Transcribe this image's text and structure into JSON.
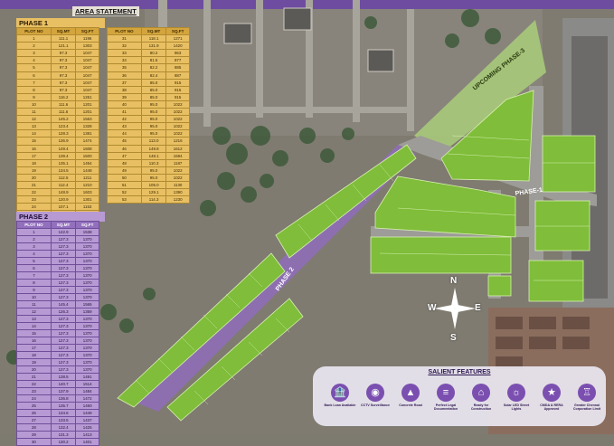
{
  "area_statement": {
    "title": "AREA STATEMENT"
  },
  "phase1_table": {
    "title": "PHASE 1",
    "headers": [
      "PLOT NO",
      "SQ.MT",
      "SQ.FT"
    ],
    "rows_left": [
      [
        "1",
        "111.1",
        "1196"
      ],
      [
        "2",
        "121.1",
        "1303"
      ],
      [
        "3",
        "97.3",
        "1047"
      ],
      [
        "4",
        "97.3",
        "1047"
      ],
      [
        "5",
        "97.3",
        "1047"
      ],
      [
        "6",
        "97.3",
        "1047"
      ],
      [
        "7",
        "97.3",
        "1047"
      ],
      [
        "8",
        "97.3",
        "1047"
      ],
      [
        "9",
        "116.2",
        "1251"
      ],
      [
        "10",
        "111.6",
        "1201"
      ],
      [
        "11",
        "111.6",
        "1201"
      ],
      [
        "12",
        "145.2",
        "1563"
      ],
      [
        "13",
        "123.4",
        "1328"
      ],
      [
        "14",
        "128.3",
        "1381"
      ],
      [
        "15",
        "136.9",
        "1474"
      ],
      [
        "16",
        "149.4",
        "1608"
      ],
      [
        "17",
        "139.4",
        "1500"
      ],
      [
        "18",
        "135.1",
        "1454"
      ],
      [
        "19",
        "134.5",
        "1448"
      ],
      [
        "20",
        "112.5",
        "1211"
      ],
      [
        "21",
        "112.4",
        "1210"
      ],
      [
        "22",
        "148.9",
        "1603"
      ],
      [
        "23",
        "120.9",
        "1301"
      ],
      [
        "24",
        "107.1",
        "1153"
      ],
      [
        "25",
        "102.3",
        "1101"
      ],
      [
        "26",
        "102.3",
        "1101"
      ],
      [
        "27",
        "119.5",
        "1286"
      ],
      [
        "28",
        "134.5",
        "1448"
      ],
      [
        "29",
        "134.5",
        "1448"
      ],
      [
        "30",
        "110.5",
        "1189"
      ]
    ],
    "rows_right": [
      [
        "31",
        "118.1",
        "1271"
      ],
      [
        "32",
        "131.9",
        "1420"
      ],
      [
        "33",
        "80.2",
        "863"
      ],
      [
        "34",
        "81.5",
        "877"
      ],
      [
        "35",
        "82.2",
        "885"
      ],
      [
        "36",
        "82.4",
        "887"
      ],
      [
        "37",
        "85.0",
        "915"
      ],
      [
        "38",
        "85.0",
        "915"
      ],
      [
        "39",
        "85.0",
        "915"
      ],
      [
        "40",
        "95.0",
        "1022"
      ],
      [
        "41",
        "95.0",
        "1022"
      ],
      [
        "42",
        "95.0",
        "1022"
      ],
      [
        "43",
        "95.0",
        "1022"
      ],
      [
        "44",
        "95.0",
        "1022"
      ],
      [
        "45",
        "113.0",
        "1216"
      ],
      [
        "46",
        "149.8",
        "1612"
      ],
      [
        "47",
        "148.1",
        "1594"
      ],
      [
        "48",
        "110.3",
        "1187"
      ],
      [
        "49",
        "95.0",
        "1022"
      ],
      [
        "50",
        "95.0",
        "1022"
      ],
      [
        "51",
        "105.0",
        "1130"
      ],
      [
        "52",
        "129.1",
        "1390"
      ],
      [
        "53",
        "114.3",
        "1230"
      ]
    ]
  },
  "phase2_table": {
    "title": "PHASE 2",
    "headers": [
      "PLOT NO",
      "SQ.MT",
      "SQ.FT"
    ],
    "rows": [
      [
        "1",
        "142.9",
        "1538"
      ],
      [
        "2",
        "127.3",
        "1370"
      ],
      [
        "3",
        "127.3",
        "1370"
      ],
      [
        "4",
        "127.3",
        "1370"
      ],
      [
        "5",
        "127.3",
        "1370"
      ],
      [
        "6",
        "127.3",
        "1370"
      ],
      [
        "7",
        "127.3",
        "1370"
      ],
      [
        "8",
        "127.3",
        "1370"
      ],
      [
        "9",
        "127.3",
        "1370"
      ],
      [
        "10",
        "127.3",
        "1370"
      ],
      [
        "11",
        "145.4",
        "1565"
      ],
      [
        "12",
        "126.3",
        "1359"
      ],
      [
        "13",
        "127.3",
        "1370"
      ],
      [
        "14",
        "127.3",
        "1370"
      ],
      [
        "15",
        "127.3",
        "1370"
      ],
      [
        "16",
        "127.3",
        "1370"
      ],
      [
        "17",
        "127.3",
        "1370"
      ],
      [
        "18",
        "127.3",
        "1370"
      ],
      [
        "19",
        "127.3",
        "1370"
      ],
      [
        "20",
        "127.3",
        "1370"
      ],
      [
        "21",
        "138.5",
        "1491"
      ],
      [
        "22",
        "140.7",
        "1514"
      ],
      [
        "23",
        "137.9",
        "1484"
      ],
      [
        "24",
        "136.8",
        "1472"
      ],
      [
        "25",
        "135.7",
        "1460"
      ],
      [
        "26",
        "134.6",
        "1449"
      ],
      [
        "27",
        "133.5",
        "1437"
      ],
      [
        "28",
        "132.4",
        "1425"
      ],
      [
        "29",
        "131.3",
        "1413"
      ],
      [
        "30",
        "130.2",
        "1401"
      ]
    ]
  },
  "map": {
    "upcoming_label": "UPCOMING PHASE-3",
    "phase1_label": "PHASE-1",
    "phase2_label": "PHASE 2",
    "colors": {
      "ground": "#7d7a6f",
      "plot": "#7fbd3a",
      "plot_border": "#d8f0b0",
      "road_phase2": "#8d6fb0",
      "road": "#9d9c98",
      "upcoming": "#a9c97a"
    }
  },
  "compass": {
    "n": "N",
    "s": "S",
    "e": "E",
    "w": "W"
  },
  "salient": {
    "title": "SALIENT FEATURES",
    "items": [
      {
        "label": "Bank Loan Available",
        "icon": "bank-icon"
      },
      {
        "label": "CCTV Surveillance",
        "icon": "cctv-icon"
      },
      {
        "label": "Concrete Road",
        "icon": "road-icon"
      },
      {
        "label": "Perfect Legal Documentation",
        "icon": "document-icon"
      },
      {
        "label": "Ready for Construction",
        "icon": "construction-icon"
      },
      {
        "label": "Solar LED Street Lights",
        "icon": "streetlight-icon"
      },
      {
        "label": "CMDA & RERA Approved",
        "icon": "approved-badge-icon"
      },
      {
        "label": "Greater Chennai Corporation Limit",
        "icon": "corporation-icon"
      }
    ]
  }
}
